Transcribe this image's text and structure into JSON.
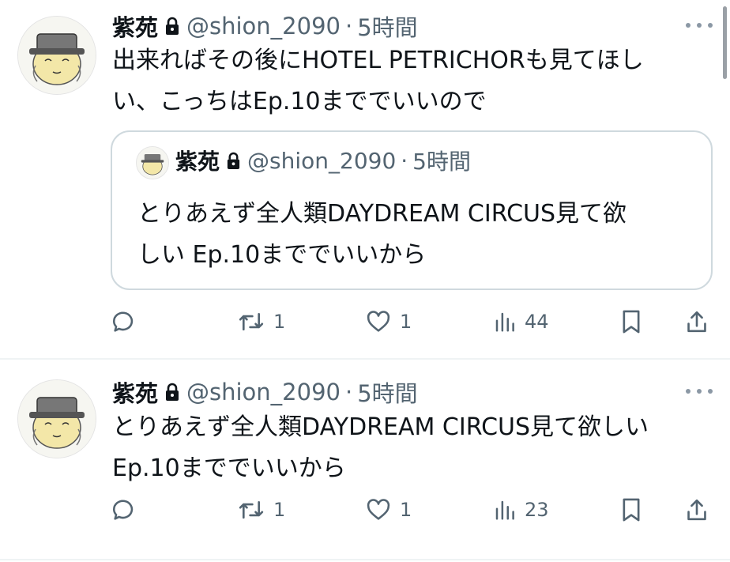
{
  "tweets": [
    {
      "name": "紫苑",
      "handle": "@shion_2090",
      "separator": "·",
      "time": "5時間",
      "text_lines": [
        "出来ればその後にHOTEL PETRICHORも見てほし",
        "い、こっちはEp.10まででいいので"
      ],
      "quote": {
        "name": "紫苑",
        "handle": "@shion_2090",
        "separator": "·",
        "time": "5時間",
        "text_lines": [
          "とりあえず全人類DAYDREAM CIRCUS見て欲",
          "しい Ep.10まででいいから"
        ]
      },
      "stats": {
        "replies": "",
        "retweets": "1",
        "likes": "1",
        "views": "44"
      }
    },
    {
      "name": "紫苑",
      "handle": "@shion_2090",
      "separator": "·",
      "time": "5時間",
      "text_lines": [
        "とりあえず全人類DAYDREAM CIRCUS見て欲しい",
        "Ep.10まででいいから"
      ],
      "stats": {
        "replies": "",
        "retweets": "1",
        "likes": "1",
        "views": "23"
      }
    }
  ],
  "icons": {
    "lock": "lock-icon",
    "more": "more-icon",
    "reply": "reply-icon",
    "retweet": "retweet-icon",
    "like": "heart-icon",
    "views": "analytics-icon",
    "bookmark": "bookmark-icon",
    "share": "share-icon"
  },
  "colors": {
    "text": "#0f1419",
    "secondary": "#536471",
    "border": "#cfd9de"
  }
}
